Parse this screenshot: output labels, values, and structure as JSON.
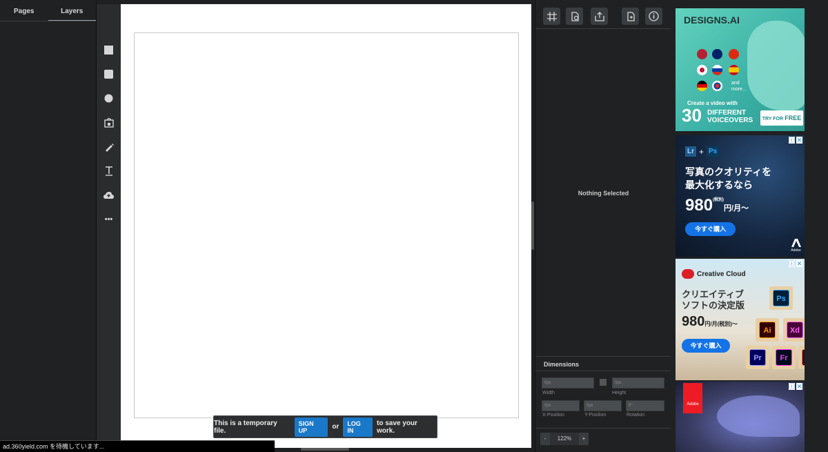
{
  "left_panel": {
    "tabs": [
      "Pages",
      "Layers"
    ]
  },
  "tools": [
    "rectangle-tool",
    "rounded-rectangle-tool",
    "ellipse-tool",
    "image-tool",
    "pen-tool",
    "text-tool",
    "upload-tool",
    "more-tools"
  ],
  "tools_more_label": "•••",
  "right_panel": {
    "empty_state": "Nothing Selected",
    "dimensions": {
      "title": "Dimensions",
      "width_value": "0px",
      "height_value": "0px",
      "x_value": "0px",
      "y_value": "0px",
      "rotation_value": "0°",
      "labels": {
        "width": "Width",
        "height": "Height",
        "x": "X-Position",
        "y": "Y-Position",
        "rotation": "Rotation"
      }
    },
    "zoom": {
      "minus": "-",
      "value": "122%",
      "plus": "+"
    }
  },
  "notice": {
    "text_before": "This is a temporary file.",
    "signup": "SIGN UP",
    "or": "or",
    "login": "LOG IN",
    "text_after": "to save your work."
  },
  "status": "ad.360yield.com を待機しています...",
  "ads": {
    "designs": {
      "brand": "DESIGNS.AI",
      "and_more": "and\nmore...",
      "line1": "Create a video with",
      "big": "30",
      "diff1": "DIFFERENT",
      "diff2": "VOICEOVERS",
      "cta_try": "TRY FOR",
      "cta_free": "FREE",
      "flag_colors": [
        "#b22234",
        "#012169",
        "#de2910",
        "#ffffff",
        "#0039a6",
        "#c60b1e",
        "#000000",
        "#ffffff"
      ]
    },
    "lrps": {
      "lr": "Lr",
      "plus": "+",
      "ps": "Ps",
      "line1": "写真のクオリティを",
      "line2": "最大化するなら",
      "price": "980",
      "price_tax": "(税別)",
      "price_unit": "円/月〜",
      "buy": "今すぐ購入",
      "brand": "Adobe"
    },
    "cc": {
      "brand": "Creative Cloud",
      "line1": "クリエイティブ",
      "line2": "ソフトの決定版",
      "price": "980",
      "price_unit": "円/月(税別)〜",
      "buy": "今すぐ購入",
      "apps": [
        "Ps",
        "Ai",
        "Xd",
        "Pr",
        "Fr",
        "◉"
      ]
    },
    "adobe4": {
      "brand": "Adobe"
    }
  }
}
